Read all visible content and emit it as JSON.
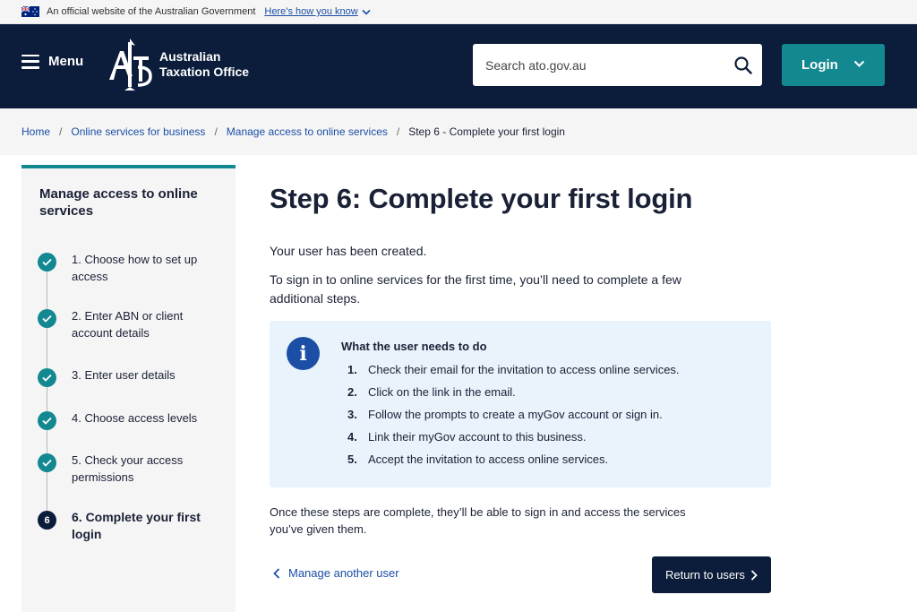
{
  "gov_banner": {
    "text": "An official website of the Australian Government",
    "link": "Here’s how you know"
  },
  "header": {
    "menu_label": "Menu",
    "logo_line1": "Australian",
    "logo_line2": "Taxation Office",
    "search_placeholder": "Search ato.gov.au",
    "login_label": "Login"
  },
  "breadcrumb": [
    "Home",
    "Online services for business",
    "Manage access to online services",
    "Step 6 - Complete your first login"
  ],
  "sidebar": {
    "title": "Manage access to online services",
    "steps": [
      {
        "label": "1. Choose how to set up access",
        "status": "complete"
      },
      {
        "label": "2. Enter ABN or client account details",
        "status": "complete"
      },
      {
        "label": "3. Enter user details",
        "status": "complete"
      },
      {
        "label": "4. Choose access levels",
        "status": "complete"
      },
      {
        "label": "5. Check your access permissions",
        "status": "complete"
      },
      {
        "label": "6. Complete your first login",
        "status": "current",
        "number": "6"
      }
    ]
  },
  "main": {
    "title": "Step 6: Complete your first login",
    "para1": "Your user has been created.",
    "para2": "To sign in to online services for the first time, you’ll need to complete a few additional steps.",
    "callout": {
      "title": "What the user needs to do",
      "items": [
        {
          "num": "1.",
          "text": "Check their email for the invitation to access online services."
        },
        {
          "num": "2.",
          "text": "Click on the link in the email."
        },
        {
          "num": "3.",
          "text": "Follow the prompts to create a myGov account or sign in."
        },
        {
          "num": "4.",
          "text": "Link their myGov account to this business."
        },
        {
          "num": "5.",
          "text": "Accept the invitation to access online services."
        }
      ]
    },
    "para3": "Once these steps are complete, they’ll be able to sign in and access the services you’ve given them.",
    "back_link": "Manage another user",
    "return_button": "Return to users"
  },
  "colors": {
    "navy": "#0b1d3a",
    "teal": "#138891",
    "link_blue": "#1b4fa6",
    "callout_bg": "#e9f3fb"
  }
}
